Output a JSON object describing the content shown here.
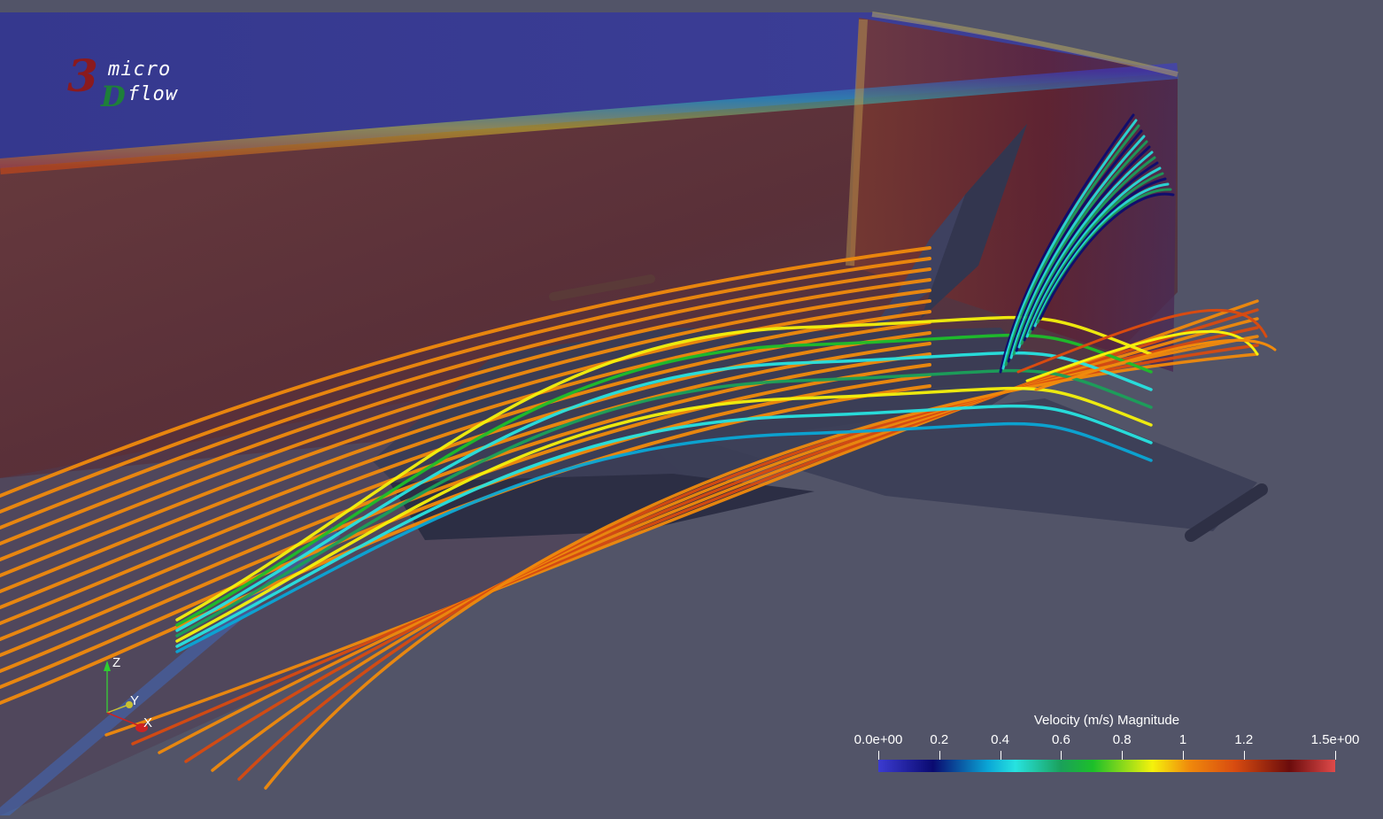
{
  "logo": {
    "digit": "3",
    "letter": "D",
    "word1": "micro",
    "word2": "flow"
  },
  "axes": {
    "z": "Z",
    "y": "Y",
    "x": "X"
  },
  "legend": {
    "title": "Velocity (m/s) Magnitude",
    "ticks": [
      "0.0e+00",
      "0.2",
      "0.4",
      "0.6",
      "0.8",
      "1",
      "1.2",
      "1.5e+00"
    ],
    "tick_values": [
      0,
      0.2,
      0.4,
      0.6,
      0.8,
      1.0,
      1.2,
      1.5
    ],
    "range": [
      0,
      1.5
    ],
    "colormap": [
      "#3b3bd1",
      "#0a0a70",
      "#0aa6d6",
      "#27e3e0",
      "#1aa05a",
      "#1cbf2a",
      "#f5f20c",
      "#f08a0c",
      "#d84b10",
      "#6b0c0c",
      "#e04a4a"
    ]
  },
  "colors": {
    "background": "#525468",
    "streamline_fast": "#f08a0c",
    "streamline_mid": "#f5f20c",
    "streamline_slow": "#27e3e0",
    "aircraft": "#3a3d55"
  }
}
